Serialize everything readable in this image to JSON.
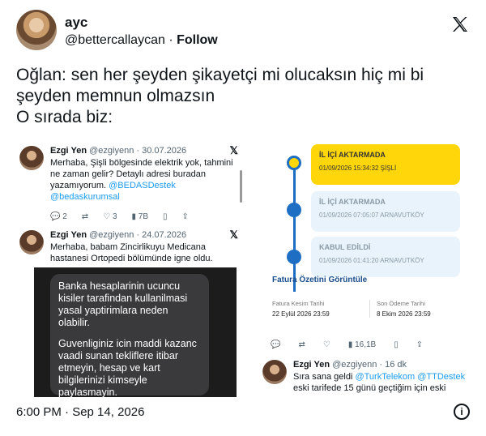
{
  "author": {
    "name": "ayc",
    "handle": "@bettercallaycan",
    "separator": "·",
    "follow": "Follow"
  },
  "tweet_lines": [
    "Oğlan: sen her şeyden şikayetçi mi olucaksın hiç mi bi",
    "şeyden memnun olmazsın",
    "O sırada biz:"
  ],
  "left_panel": {
    "tweet1": {
      "name": "Ezgi Yen",
      "meta": "@ezgiyenn · 30.07.2026",
      "body": "Merhaba, Şişli bölgesinde elektrik yok, tahmini ne zaman gelir? Detaylı adresi buradan yazamıyorum.",
      "mentions": "@BEDASDestek @bedaskurumsal",
      "replies": "2",
      "likes": "3",
      "views": "7B"
    },
    "tweet2": {
      "name": "Ezgi Yen",
      "meta": "@ezgiyenn · 24.07.2026",
      "body": "Merhaba, babam Zincirlikuyu Medicana hastanesi Ortopedi bölümünde igne oldu."
    },
    "bubble_lines_1": [
      "Banka hesaplarinin ucuncu",
      "kisiler tarafindan kullanilmasi",
      "yasal yaptirimlara neden",
      "olabilir."
    ],
    "bubble_lines_2": [
      "Guvenliginiz icin maddi kazanc",
      "vaadi sunan tekliflere itibar",
      "etmeyin, hesap ve kart",
      "bilgilerinizi kimseyle",
      "paylasmayin."
    ]
  },
  "right_panel": {
    "steps": [
      {
        "title": "İL İÇİ AKTARMADA",
        "date": "01/09/2026 15:34:32 ŞİŞLİ"
      },
      {
        "title": "İL İÇİ AKTARMADA",
        "date": "01/09/2026 07:05:07 ARNAVUTKÖY"
      },
      {
        "title": "KABUL EDİLDİ",
        "date": "01/09/2026 01:41:20 ARNAVUTKÖY"
      }
    ],
    "invoice_title": "Fatura Özetini Görüntüle",
    "issue_label": "Fatura Kesim Tarihi",
    "issue_date": "22 Eylül 2026 23:59",
    "due_label": "Son Ödeme Tarihi",
    "due_date": "8 Ekim 2026 23:59",
    "views": "16,1B",
    "tweet3": {
      "name": "Ezgi Yen",
      "meta": "@ezgiyenn · 16 dk",
      "body": "Sıra sana geldi",
      "mentions": "@TurkTelekom @TTDestek",
      "body2": "eski tarifede 15 günü geçtiğim için eski"
    }
  },
  "footer": {
    "timestamp": "6:00 PM · Sep 14, 2026"
  },
  "colors": {
    "link": "#1d9bf0",
    "step_active": "#ffd60a",
    "step_done": "#e8f3fb",
    "timeline": "#1e6fc4"
  }
}
